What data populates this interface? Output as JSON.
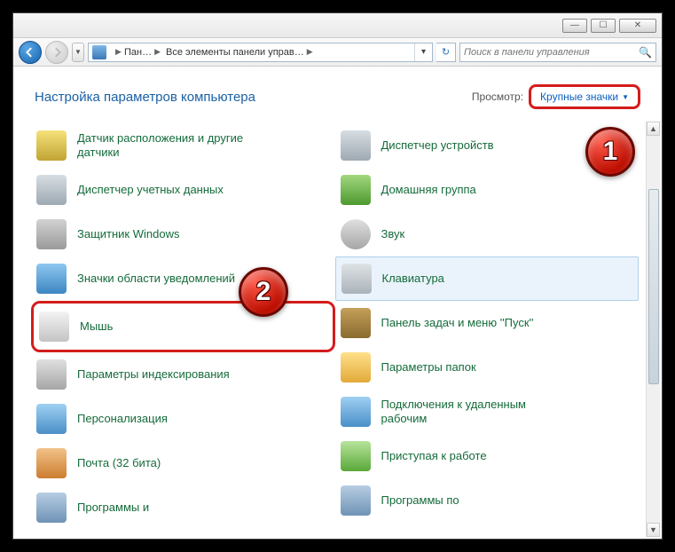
{
  "window": {
    "min": "—",
    "max": "☐",
    "close": "✕"
  },
  "breadcrumb": {
    "seg1": "Пан…",
    "seg2": "Все элементы панели управ…"
  },
  "search": {
    "placeholder": "Поиск в панели управления"
  },
  "header": {
    "title": "Настройка параметров компьютера",
    "viewby_label": "Просмотр:",
    "viewby_value": "Крупные значки"
  },
  "badges": {
    "one": "1",
    "two": "2"
  },
  "left": [
    {
      "label": "Датчик расположения и другие датчики",
      "icon": "i-sensor",
      "name": "item-location-sensor"
    },
    {
      "label": "Диспетчер учетных данных",
      "icon": "i-cred",
      "name": "item-credential-manager"
    },
    {
      "label": "Защитник Windows",
      "icon": "i-def",
      "name": "item-windows-defender"
    },
    {
      "label": "Значки области уведомлений",
      "icon": "i-tray",
      "name": "item-notification-icons"
    },
    {
      "label": "Мышь",
      "icon": "i-mouse",
      "name": "item-mouse",
      "highlight": true
    },
    {
      "label": "Параметры индексирования",
      "icon": "i-index",
      "name": "item-indexing-options"
    },
    {
      "label": "Персонализация",
      "icon": "i-person",
      "name": "item-personalization"
    },
    {
      "label": "Почта (32 бита)",
      "icon": "i-mail",
      "name": "item-mail-32"
    },
    {
      "label": "Программы и",
      "icon": "i-prog",
      "name": "item-programs-and"
    }
  ],
  "right": [
    {
      "label": "Диспетчер устройств",
      "icon": "i-devmgr",
      "name": "item-device-manager"
    },
    {
      "label": "Домашняя группа",
      "icon": "i-home",
      "name": "item-homegroup"
    },
    {
      "label": "Звук",
      "icon": "i-sound",
      "name": "item-sound"
    },
    {
      "label": "Клавиатура",
      "icon": "i-kb",
      "name": "item-keyboard",
      "selected": true
    },
    {
      "label": "Панель задач и меню ''Пуск''",
      "icon": "i-task",
      "name": "item-taskbar-start"
    },
    {
      "label": "Параметры папок",
      "icon": "i-folder",
      "name": "item-folder-options"
    },
    {
      "label": "Подключения к удаленным рабочим",
      "icon": "i-remote",
      "name": "item-remote-connections"
    },
    {
      "label": "Приступая к работе",
      "icon": "i-start",
      "name": "item-getting-started"
    },
    {
      "label": "Программы по",
      "icon": "i-prog",
      "name": "item-programs-by"
    }
  ]
}
